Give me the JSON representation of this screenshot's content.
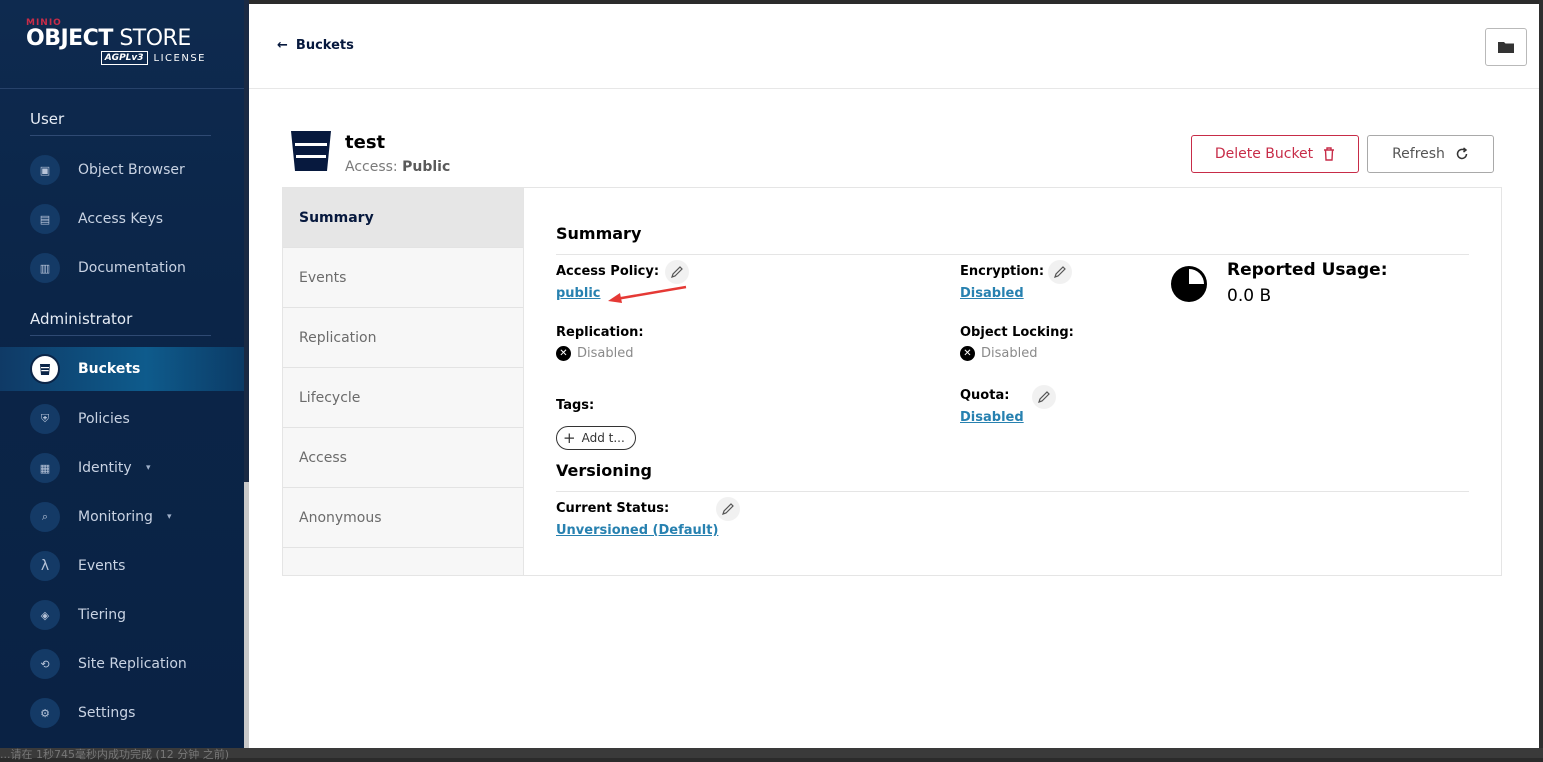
{
  "brand": {
    "minio": "MINIO",
    "name_bold": "OBJECT",
    "name_rest": " STORE",
    "agpl": "AGPLv3",
    "license": "LICENSE"
  },
  "sidebar": {
    "user_title": "User",
    "admin_title": "Administrator",
    "user_items": [
      {
        "label": "Object Browser",
        "icon": "object-browser-icon"
      },
      {
        "label": "Access Keys",
        "icon": "access-keys-icon"
      },
      {
        "label": "Documentation",
        "icon": "documentation-icon"
      }
    ],
    "admin_items": [
      {
        "label": "Buckets",
        "icon": "bucket-icon",
        "active": true
      },
      {
        "label": "Policies",
        "icon": "policies-icon"
      },
      {
        "label": "Identity",
        "icon": "identity-icon",
        "has_chevron": true
      },
      {
        "label": "Monitoring",
        "icon": "monitoring-icon",
        "has_chevron": true
      },
      {
        "label": "Events",
        "icon": "lambda-icon"
      },
      {
        "label": "Tiering",
        "icon": "tiering-icon"
      },
      {
        "label": "Site Replication",
        "icon": "site-replication-icon"
      },
      {
        "label": "Settings",
        "icon": "settings-icon"
      }
    ]
  },
  "topbar": {
    "back_label": "Buckets"
  },
  "bucket": {
    "name": "test",
    "access_label": "Access:",
    "access_value": "Public"
  },
  "actions": {
    "delete_label": "Delete Bucket",
    "refresh_label": "Refresh"
  },
  "tabs": [
    "Summary",
    "Events",
    "Replication",
    "Lifecycle",
    "Access",
    "Anonymous"
  ],
  "summary": {
    "title": "Summary",
    "access_policy_label": "Access Policy:",
    "access_policy_value": "public",
    "encryption_label": "Encryption:",
    "encryption_value": "Disabled",
    "replication_label": "Replication:",
    "replication_value": "Disabled",
    "object_locking_label": "Object Locking:",
    "object_locking_value": "Disabled",
    "tags_label": "Tags:",
    "add_tag_label": "Add t...",
    "quota_label": "Quota:",
    "quota_value": "Disabled",
    "usage_title": "Reported Usage:",
    "usage_value": "0.0 B"
  },
  "versioning": {
    "title": "Versioning",
    "status_label": "Current Status:",
    "status_value": "Unversioned (Default)"
  },
  "colors": {
    "brand_red": "#c72c48",
    "sidebar_bg": "#0b2548",
    "link": "#2781b0",
    "annotation_arrow": "#e53935"
  },
  "footer": {
    "status_text": "...请在 1秒745毫秒内成功完成 (12 分钟 之前)"
  }
}
